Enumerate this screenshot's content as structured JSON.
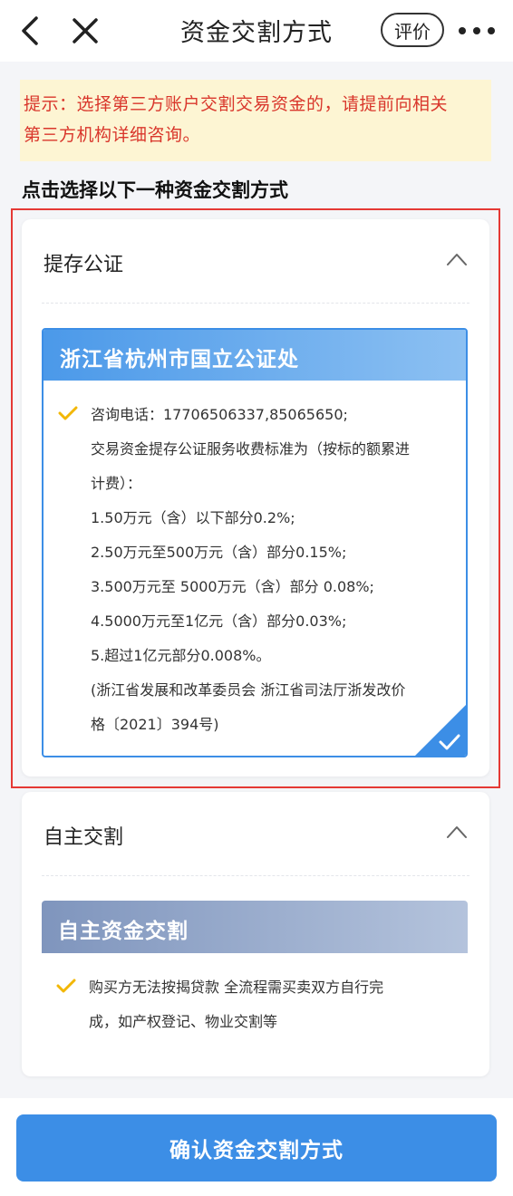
{
  "header": {
    "title": "资金交割方式",
    "rate_label": "评价",
    "icons": {
      "back": "chevron-left-icon",
      "close": "close-icon",
      "more": "more-horizontal-icon"
    }
  },
  "notice": {
    "line1": "提示：选择第三方账户交割交易资金的，请提前向相关",
    "line2": "第三方机构详细咨询。"
  },
  "section_title": "点击选择以下一种资金交割方式",
  "cards": [
    {
      "label": "提存公证",
      "option_title": "浙江省杭州市国立公证处",
      "lines": [
        "咨询电话：17706506337,85065650;",
        "交易资金提存公证服务收费标准为（按标的额累进",
        "计费）：",
        "1.50万元（含）以下部分0.2%;",
        "2.50万元至500万元（含）部分0.15%;",
        "3.500万元至 5000万元（含）部分 0.08%;",
        "4.5000万元至1亿元（含）部分0.03%;",
        "5.超过1亿元部分0.008%。",
        "(浙江省发展和改革委员会 浙江省司法厅浙发改价",
        "格〔2021〕394号)"
      ],
      "selected": true
    },
    {
      "label": "自主交割",
      "option_title": "自主资金交割",
      "lines": [
        "购买方无法按揭贷款 全流程需买卖双方自行完",
        "成，如产权登记、物业交割等"
      ],
      "selected": false
    }
  ],
  "confirm_label": "确认资金交割方式",
  "colors": {
    "accent": "#3c8ee6",
    "notice_bg": "#fdf5d3",
    "notice_text": "#d9362b",
    "selection_frame": "#e53935",
    "check": "#f2b705"
  }
}
